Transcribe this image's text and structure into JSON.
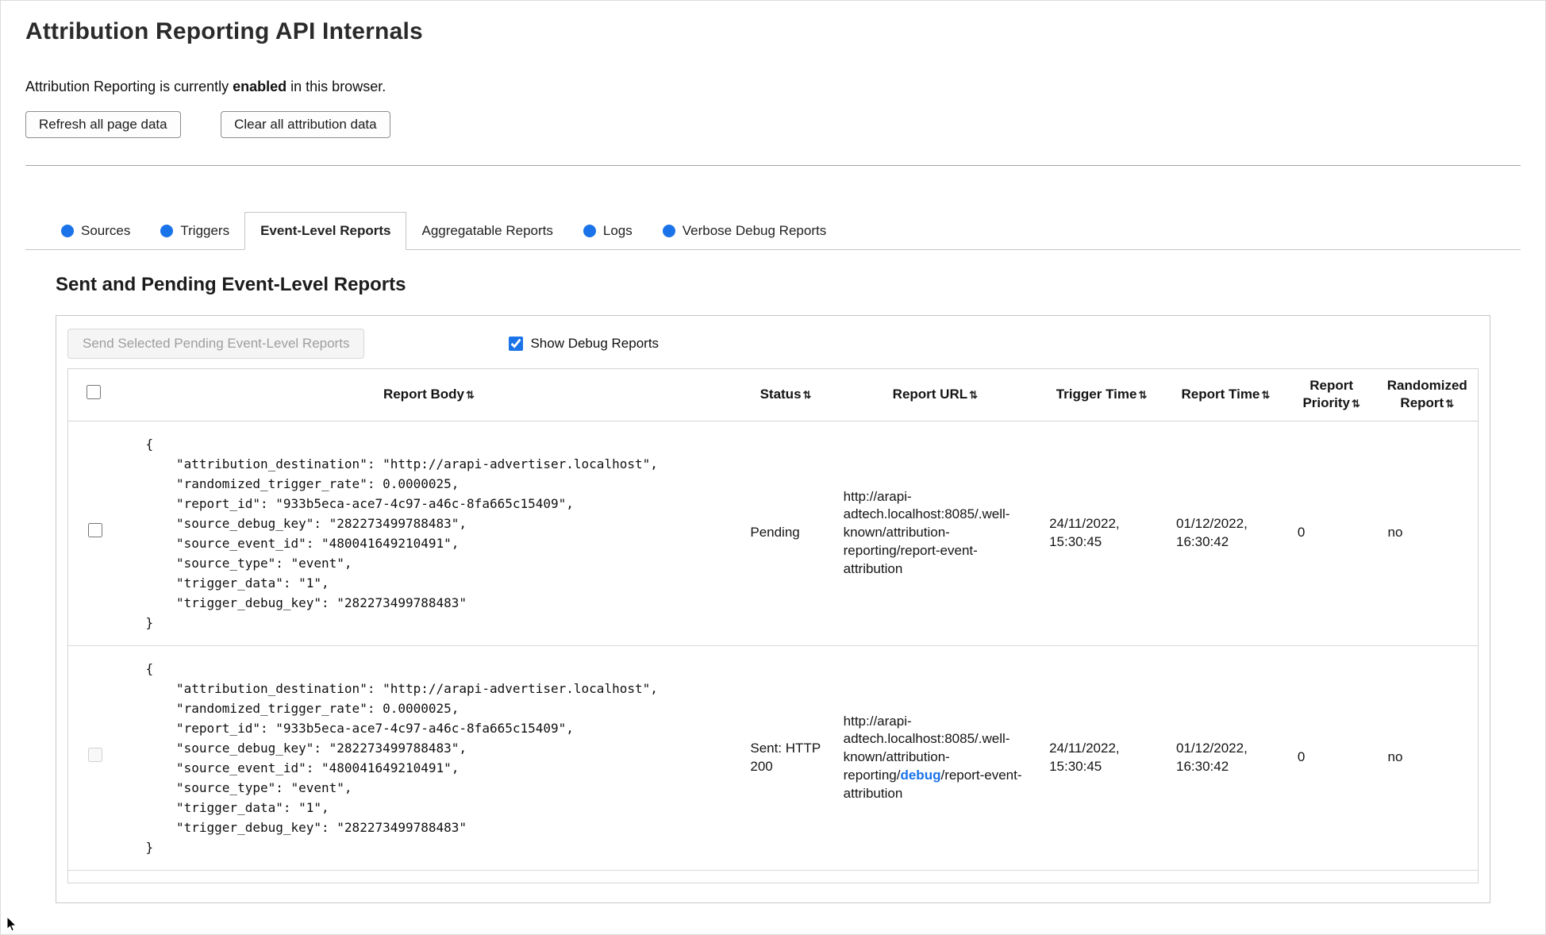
{
  "colors": {
    "accent": "#1a73e8"
  },
  "header": {
    "title": "Attribution Reporting API Internals",
    "status_prefix": "Attribution Reporting is currently ",
    "status_emphasis": "enabled",
    "status_suffix": " in this browser.",
    "refresh_button": "Refresh all page data",
    "clear_button": "Clear all attribution data"
  },
  "tabs": {
    "items": [
      {
        "label": "Sources",
        "has_dot": true,
        "active": false
      },
      {
        "label": "Triggers",
        "has_dot": true,
        "active": false
      },
      {
        "label": "Event-Level Reports",
        "has_dot": false,
        "active": true
      },
      {
        "label": "Aggregatable Reports",
        "has_dot": false,
        "active": false
      },
      {
        "label": "Logs",
        "has_dot": true,
        "active": false
      },
      {
        "label": "Verbose Debug Reports",
        "has_dot": true,
        "active": false
      }
    ]
  },
  "section": {
    "heading": "Sent and Pending Event-Level Reports"
  },
  "controls": {
    "send_button_label": "Send Selected Pending Event-Level Reports",
    "send_button_disabled": true,
    "show_debug_label": "Show Debug Reports",
    "show_debug_checked": true
  },
  "table": {
    "sort_icon": "⇅",
    "select_all_checked": false,
    "headers": [
      "Report Body",
      "Status",
      "Report URL",
      "Trigger Time",
      "Report Time",
      "Report Priority",
      "Randomized Report"
    ],
    "rows": [
      {
        "selected": false,
        "checkbox_disabled": false,
        "report_body": "{\n    \"attribution_destination\": \"http://arapi-advertiser.localhost\",\n    \"randomized_trigger_rate\": 0.0000025,\n    \"report_id\": \"933b5eca-ace7-4c97-a46c-8fa665c15409\",\n    \"source_debug_key\": \"282273499788483\",\n    \"source_event_id\": \"480041649210491\",\n    \"source_type\": \"event\",\n    \"trigger_data\": \"1\",\n    \"trigger_debug_key\": \"282273499788483\"\n}",
        "status": "Pending",
        "url_prefix": "http://arapi-adtech.localhost:8085/.well-known/attribution-reporting/",
        "url_highlight": "",
        "url_suffix": "report-event-attribution",
        "trigger_time": "24/11/2022, 15:30:45",
        "report_time": "01/12/2022, 16:30:42",
        "report_priority": "0",
        "randomized_report": "no"
      },
      {
        "selected": false,
        "checkbox_disabled": true,
        "report_body": "{\n    \"attribution_destination\": \"http://arapi-advertiser.localhost\",\n    \"randomized_trigger_rate\": 0.0000025,\n    \"report_id\": \"933b5eca-ace7-4c97-a46c-8fa665c15409\",\n    \"source_debug_key\": \"282273499788483\",\n    \"source_event_id\": \"480041649210491\",\n    \"source_type\": \"event\",\n    \"trigger_data\": \"1\",\n    \"trigger_debug_key\": \"282273499788483\"\n}",
        "status": "Sent: HTTP 200",
        "url_prefix": "http://arapi-adtech.localhost:8085/.well-known/attribution-reporting/",
        "url_highlight": "debug",
        "url_suffix": "/report-event-attribution",
        "trigger_time": "24/11/2022, 15:30:45",
        "report_time": "01/12/2022, 16:30:42",
        "report_priority": "0",
        "randomized_report": "no"
      }
    ]
  }
}
